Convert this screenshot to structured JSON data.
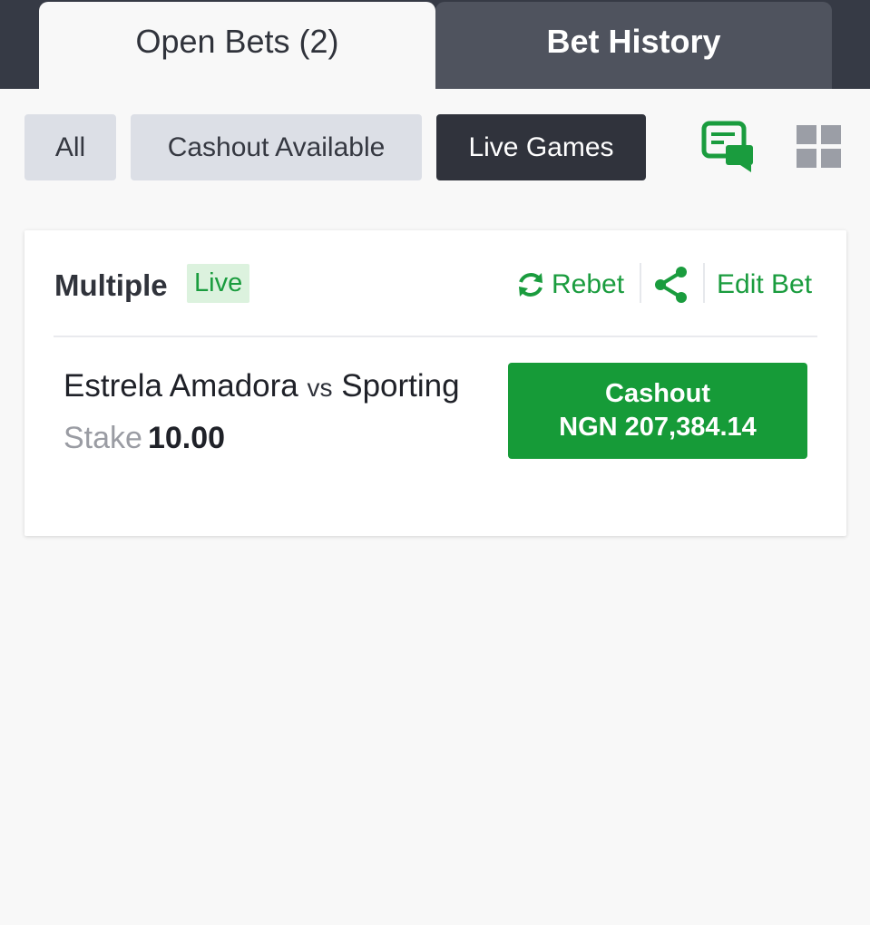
{
  "tabs": {
    "open_bets": "Open Bets (2)",
    "bet_history": "Bet History"
  },
  "filters": {
    "all": "All",
    "cashout_available": "Cashout Available",
    "live_games": "Live Games",
    "active": "Live Games"
  },
  "icons": {
    "chat": "bet-slip-chat-icon",
    "grid": "grid-view-icon",
    "rebet": "refresh-icon",
    "share": "share-icon"
  },
  "colors": {
    "accent_green": "#1a9c3e",
    "cashout_green": "#169b38",
    "dark": "#30333c",
    "topbar": "#363a45"
  },
  "bet": {
    "type": "Multiple",
    "badge": "Live",
    "rebet": "Rebet",
    "edit_bet": "Edit Bet",
    "home": "Estrela Amadora",
    "vs": "vs",
    "away": "Sporting",
    "stake_label": "Stake",
    "stake_value": "10.00",
    "cashout_label": "Cashout",
    "cashout_amount": "NGN 207,384.14"
  }
}
